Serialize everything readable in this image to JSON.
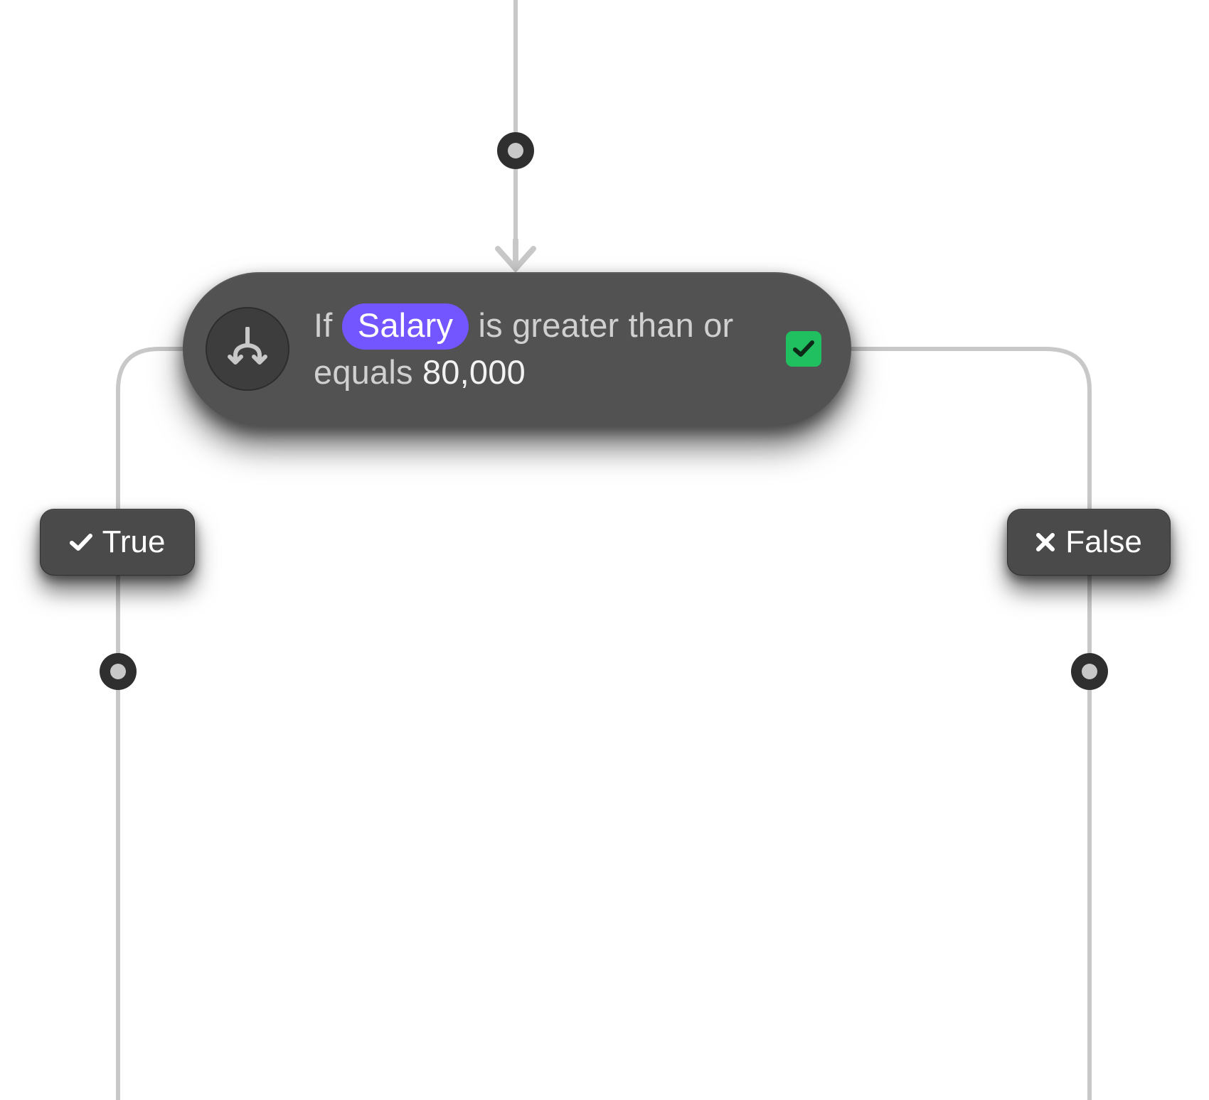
{
  "condition": {
    "prefix": "If",
    "fieldLabel": "Salary",
    "operatorText": "is greater than or equals",
    "value": "80,000",
    "status": "passed"
  },
  "branches": {
    "trueLabel": "True",
    "falseLabel": "False"
  },
  "colors": {
    "fieldPill": "#7356ff",
    "statusOk": "#20c060"
  }
}
